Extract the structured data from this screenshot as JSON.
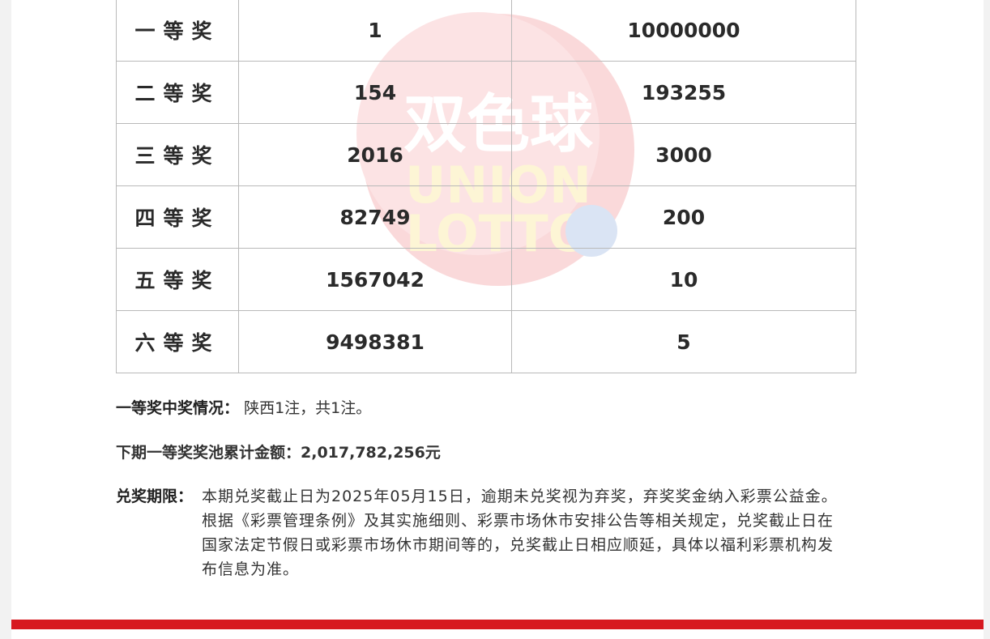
{
  "prize_table": {
    "rows": [
      {
        "level": "一等奖",
        "count": "1",
        "amount": "10000000"
      },
      {
        "level": "二等奖",
        "count": "154",
        "amount": "193255"
      },
      {
        "level": "三等奖",
        "count": "2016",
        "amount": "3000"
      },
      {
        "level": "四等奖",
        "count": "82749",
        "amount": "200"
      },
      {
        "level": "五等奖",
        "count": "1567042",
        "amount": "10"
      },
      {
        "level": "六等奖",
        "count": "9498381",
        "amount": "5"
      }
    ]
  },
  "watermark": {
    "cn": "双色球",
    "en_line1": "UNION",
    "en_line2": "LOTTO"
  },
  "first_prize": {
    "label": "一等奖中奖情况：",
    "value": "陕西1注，共1注。"
  },
  "pool": {
    "label": "下期一等奖奖池累计金额：",
    "value": "2,017,782,256元"
  },
  "redeem": {
    "label": "兑奖期限：",
    "text": "本期兑奖截止日为2025年05月15日，逾期未兑奖视为弃奖，弃奖奖金纳入彩票公益金。根据《彩票管理条例》及其实施细则、彩票市场休市安排公告等相关规定，兑奖截止日在国家法定节假日或彩票市场休市期间等的，兑奖截止日相应顺延，具体以福利彩票机构发布信息为准。"
  },
  "colors": {
    "accent": "#d7191f",
    "border": "#b9b9b9"
  }
}
